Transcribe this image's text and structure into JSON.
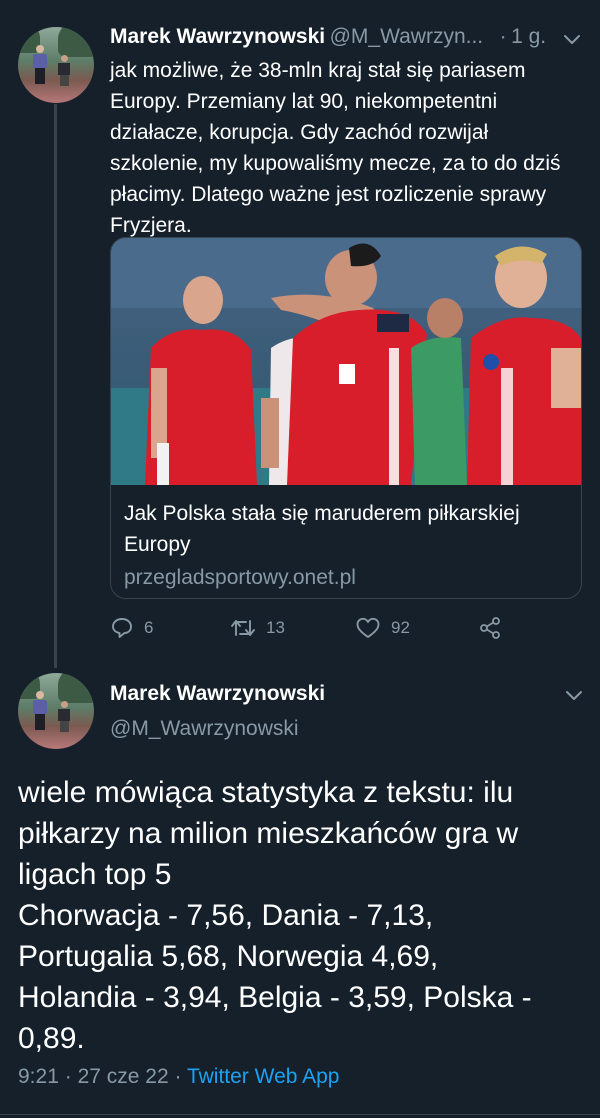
{
  "tweet1": {
    "author_name": "Marek Wawrzynowski",
    "author_handle": "@M_Wawrzyn...",
    "separator": "·",
    "time": "1 g.",
    "text": "jak możliwe, że 38-mln kraj stał się pariasem Europy. Przemiany lat 90, niekompetentni działacze, korupcja. Gdy zachód rozwijał szkolenie, my kupowaliśmy mecze, za to do dziś płacimy. Dlatego ważne jest rozliczenie sprawy Fryzjera.",
    "card": {
      "title": "Jak Polska stała się maruderem piłkarskiej Europy",
      "domain": "przegladsportowy.onet.pl"
    },
    "actions": {
      "replies": "6",
      "retweets": "13",
      "likes": "92"
    }
  },
  "tweet2": {
    "author_name": "Marek Wawrzynowski",
    "author_handle": "@M_Wawrzynowski",
    "text_lines": [
      "wiele mówiąca statystyka z tekstu: ilu",
      "piłkarzy na milion mieszkańców gra w",
      "ligach top 5",
      "Chorwacja - 7,56, Dania - 7,13,",
      "Portugalia 5,68, Norwegia 4,69,",
      "Holandia - 3,94, Belgia - 3,59, Polska -",
      "0,89."
    ],
    "time": "9:21",
    "separator": "·",
    "date": "27 cze 22",
    "separator2": "·",
    "client": "Twitter Web App"
  },
  "icons": {
    "reply": "reply-icon",
    "retweet": "retweet-icon",
    "like": "heart-icon",
    "share": "share-icon",
    "menu": "chevron-down-icon"
  },
  "colors": {
    "background": "#15202b",
    "muted": "#8899a6",
    "link": "#1da1f2",
    "border": "#38444d",
    "shirt": "#d81e2a"
  }
}
